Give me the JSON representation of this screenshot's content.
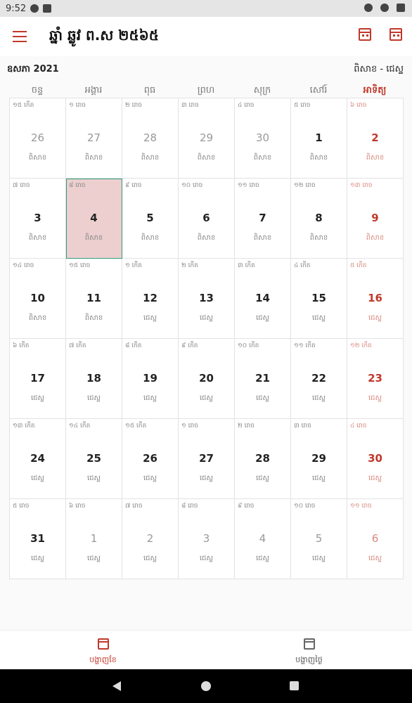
{
  "status": {
    "time": "9:52"
  },
  "app": {
    "title": "ឆ្នាំ ឆ្លូវ ព.ស ២៥៦៥"
  },
  "month": {
    "left": "ឧសភា 2021",
    "right": "ពិសាខ - ជេស្ឋ"
  },
  "weekdays": [
    "ចន្ទ",
    "អង្គារ",
    "ពុធ",
    "ព្រហ",
    "សុក្រ",
    "សៅរ៍",
    "អាទិត្យ"
  ],
  "calendar": {
    "weeks": [
      [
        {
          "lunar": "១៥ កើត",
          "day": "26",
          "month": "ពិសាខ"
        },
        {
          "lunar": "១ រោច",
          "day": "27",
          "month": "ពិសាខ"
        },
        {
          "lunar": "២ រោច",
          "day": "28",
          "month": "ពិសាខ"
        },
        {
          "lunar": "៣ រោច",
          "day": "29",
          "month": "ពិសាខ"
        },
        {
          "lunar": "៤ រោច",
          "day": "30",
          "month": "ពិសាខ"
        },
        {
          "lunar": "៥ រោច",
          "day": "1",
          "month": "ពិសាខ"
        },
        {
          "lunar": "៦ រោច",
          "day": "2",
          "month": "ពិសាខ"
        }
      ],
      [
        {
          "lunar": "៧ រោច",
          "day": "3",
          "month": "ពិសាខ"
        },
        {
          "lunar": "៨ រោច",
          "day": "4",
          "month": "ពិសាខ"
        },
        {
          "lunar": "៩ រោច",
          "day": "5",
          "month": "ពិសាខ"
        },
        {
          "lunar": "១០ រោច",
          "day": "6",
          "month": "ពិសាខ"
        },
        {
          "lunar": "១១ រោច",
          "day": "7",
          "month": "ពិសាខ"
        },
        {
          "lunar": "១២ រោច",
          "day": "8",
          "month": "ពិសាខ"
        },
        {
          "lunar": "១៣ រោច",
          "day": "9",
          "month": "ពិសាខ"
        }
      ],
      [
        {
          "lunar": "១៤ រោច",
          "day": "10",
          "month": "ពិសាខ"
        },
        {
          "lunar": "១៥ រោច",
          "day": "11",
          "month": "ពិសាខ"
        },
        {
          "lunar": "១ កើត",
          "day": "12",
          "month": "ជេស្ឋ"
        },
        {
          "lunar": "២ កើត",
          "day": "13",
          "month": "ជេស្ឋ"
        },
        {
          "lunar": "៣ កើត",
          "day": "14",
          "month": "ជេស្ឋ"
        },
        {
          "lunar": "៤ កើត",
          "day": "15",
          "month": "ជេស្ឋ"
        },
        {
          "lunar": "៥ កើត",
          "day": "16",
          "month": "ជេស្ឋ"
        }
      ],
      [
        {
          "lunar": "៦ កើត",
          "day": "17",
          "month": "ជេស្ឋ"
        },
        {
          "lunar": "៧ កើត",
          "day": "18",
          "month": "ជេស្ឋ"
        },
        {
          "lunar": "៨ កើត",
          "day": "19",
          "month": "ជេស្ឋ"
        },
        {
          "lunar": "៩ កើត",
          "day": "20",
          "month": "ជេស្ឋ"
        },
        {
          "lunar": "១០ កើត",
          "day": "21",
          "month": "ជេស្ឋ"
        },
        {
          "lunar": "១១ កើត",
          "day": "22",
          "month": "ជេស្ឋ"
        },
        {
          "lunar": "១២ កើត",
          "day": "23",
          "month": "ជេស្ឋ"
        }
      ],
      [
        {
          "lunar": "១៣ កើត",
          "day": "24",
          "month": "ជេស្ឋ"
        },
        {
          "lunar": "១៤ កើត",
          "day": "25",
          "month": "ជេស្ឋ"
        },
        {
          "lunar": "១៥ កើត",
          "day": "26",
          "month": "ជេស្ឋ"
        },
        {
          "lunar": "១ រោច",
          "day": "27",
          "month": "ជេស្ឋ"
        },
        {
          "lunar": "២ រោច",
          "day": "28",
          "month": "ជេស្ឋ"
        },
        {
          "lunar": "៣ រោច",
          "day": "29",
          "month": "ជេស្ឋ"
        },
        {
          "lunar": "៤ រោច",
          "day": "30",
          "month": "ជេស្ឋ"
        }
      ],
      [
        {
          "lunar": "៥ រោច",
          "day": "31",
          "month": "ជេស្ឋ"
        },
        {
          "lunar": "៦ រោច",
          "day": "1",
          "month": "ជេស្ឋ"
        },
        {
          "lunar": "៧ រោច",
          "day": "2",
          "month": "ជេស្ឋ"
        },
        {
          "lunar": "៨ រោច",
          "day": "3",
          "month": "ជេស្ឋ"
        },
        {
          "lunar": "៩ រោច",
          "day": "4",
          "month": "ជេស្ឋ"
        },
        {
          "lunar": "១០ រោច",
          "day": "5",
          "month": "ជេស្ឋ"
        },
        {
          "lunar": "១១ រោច",
          "day": "6",
          "month": "ជេស្ឋ"
        }
      ]
    ]
  },
  "bottom_nav": [
    {
      "label": "បង្ហាញខែ",
      "active": true
    },
    {
      "label": "បង្ហាញថ្ងៃ",
      "active": false
    }
  ],
  "colors": {
    "accent": "#c0392b",
    "selected": "#edcfcf",
    "selected_border": "#2e9e7e"
  }
}
